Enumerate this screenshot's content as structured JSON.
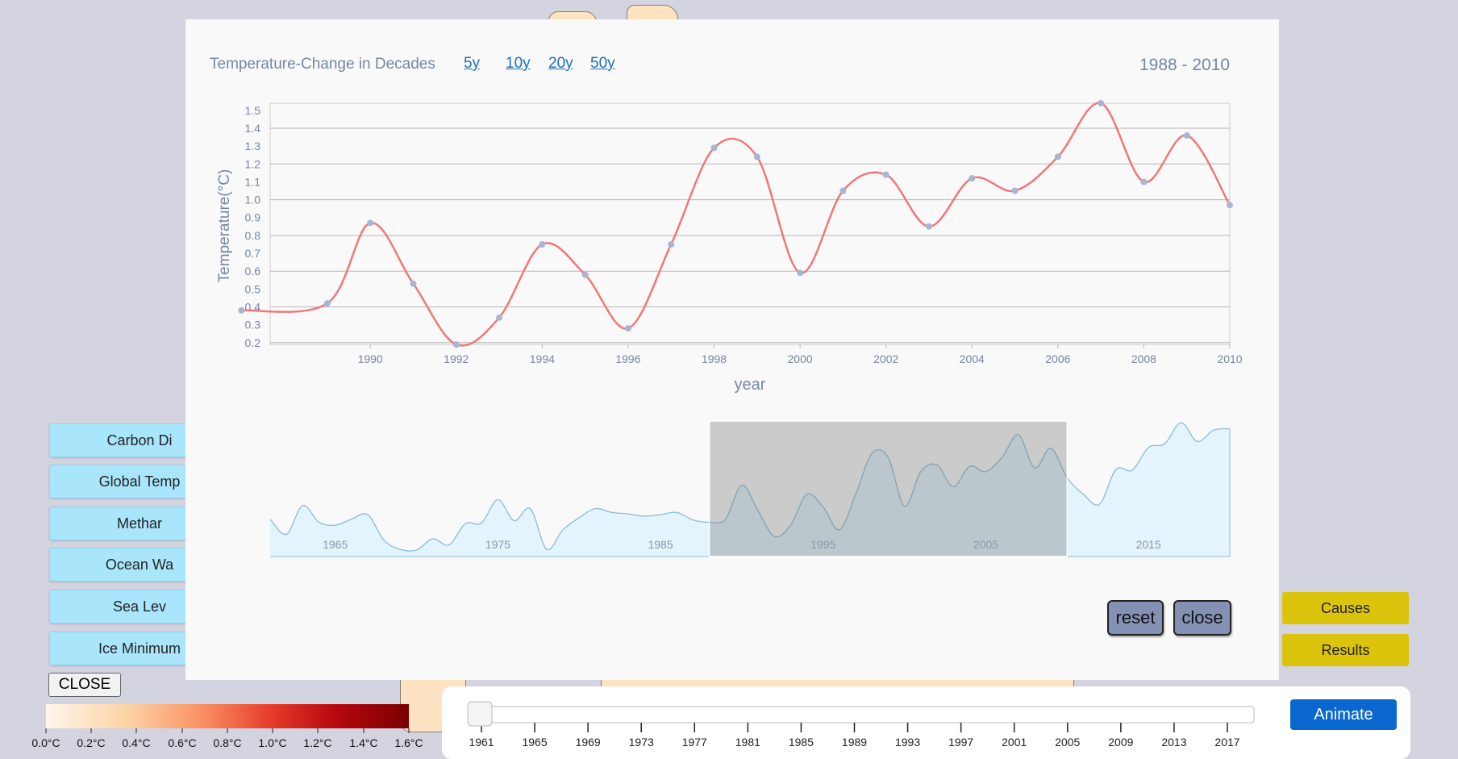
{
  "sidebar": {
    "buttons": [
      "Carbon Di",
      "Global Temp",
      "Methar",
      "Ocean Wa",
      "Sea Lev",
      "Ice Minimum"
    ],
    "close_label": "CLOSE"
  },
  "right_buttons": [
    "Causes",
    "Results"
  ],
  "color_legend": {
    "labels": [
      "0.0°C",
      "0.2°C",
      "0.4°C",
      "0.6°C",
      "0.8°C",
      "1.0°C",
      "1.2°C",
      "1.4°C",
      "1.6°C"
    ]
  },
  "timeline": {
    "years": [
      "1961",
      "1965",
      "1969",
      "1973",
      "1977",
      "1981",
      "1985",
      "1989",
      "1993",
      "1997",
      "2001",
      "2005",
      "2009",
      "2013",
      "2017"
    ],
    "value": 1961,
    "animate_label": "Animate"
  },
  "modal": {
    "title": "Temperature-Change in Decades",
    "range_links": [
      "5y",
      "10y",
      "20y",
      "50y"
    ],
    "year_range": "1988 - 2010",
    "reset_label": "reset",
    "close_label": "close"
  },
  "chart_data": {
    "type": "line",
    "xlabel": "year",
    "ylabel": "Temperature(°C)",
    "xlim": [
      1987.67,
      2010
    ],
    "ylim": [
      0.19,
      1.54
    ],
    "x_ticks": [
      1990,
      1992,
      1994,
      1996,
      1998,
      2000,
      2002,
      2004,
      2006,
      2008,
      2010
    ],
    "y_ticks": [
      0.2,
      0.3,
      0.4,
      0.5,
      0.6,
      0.7,
      0.8,
      0.9,
      1.0,
      1.1,
      1.2,
      1.3,
      1.4,
      1.5
    ],
    "x": [
      1987,
      1989,
      1990,
      1991,
      1992,
      1993,
      1994,
      1995,
      1996,
      1997,
      1998,
      1999,
      2000,
      2001,
      2002,
      2003,
      2004,
      2005,
      2006,
      2007,
      2008,
      2009,
      2010
    ],
    "y": [
      0.38,
      0.42,
      0.87,
      0.53,
      0.19,
      0.34,
      0.75,
      0.58,
      0.28,
      0.75,
      1.29,
      1.24,
      0.59,
      1.05,
      1.14,
      0.85,
      1.12,
      1.05,
      1.24,
      1.54,
      1.1,
      1.36,
      0.97
    ],
    "line_color": "#f07878",
    "point_color": "#a8b6d3",
    "navigator": {
      "x_ticks": [
        1965,
        1975,
        1985,
        1995,
        2005,
        2015
      ],
      "xlim": [
        1961,
        2020
      ],
      "selected_range": [
        1988,
        2010
      ],
      "series": [
        [
          1961,
          0.42
        ],
        [
          1962,
          0.22
        ],
        [
          1963,
          0.6
        ],
        [
          1964,
          0.38
        ],
        [
          1965,
          0.34
        ],
        [
          1966,
          0.42
        ],
        [
          1967,
          0.48
        ],
        [
          1968,
          0.14
        ],
        [
          1969,
          0.02
        ],
        [
          1970,
          0.01
        ],
        [
          1971,
          0.16
        ],
        [
          1972,
          0.08
        ],
        [
          1973,
          0.36
        ],
        [
          1974,
          0.37
        ],
        [
          1975,
          0.68
        ],
        [
          1976,
          0.4
        ],
        [
          1977,
          0.56
        ],
        [
          1978,
          0.02
        ],
        [
          1979,
          0.28
        ],
        [
          1980,
          0.44
        ],
        [
          1981,
          0.56
        ],
        [
          1982,
          0.51
        ],
        [
          1983,
          0.49
        ],
        [
          1984,
          0.46
        ],
        [
          1985,
          0.48
        ],
        [
          1986,
          0.51
        ],
        [
          1987,
          0.41
        ],
        [
          1988,
          0.38
        ],
        [
          1989,
          0.42
        ],
        [
          1990,
          0.87
        ],
        [
          1991,
          0.53
        ],
        [
          1992,
          0.19
        ],
        [
          1993,
          0.34
        ],
        [
          1994,
          0.75
        ],
        [
          1995,
          0.58
        ],
        [
          1996,
          0.28
        ],
        [
          1997,
          0.75
        ],
        [
          1998,
          1.29
        ],
        [
          1999,
          1.24
        ],
        [
          2000,
          0.59
        ],
        [
          2001,
          1.05
        ],
        [
          2002,
          1.14
        ],
        [
          2003,
          0.85
        ],
        [
          2004,
          1.12
        ],
        [
          2005,
          1.05
        ],
        [
          2006,
          1.24
        ],
        [
          2007,
          1.54
        ],
        [
          2008,
          1.1
        ],
        [
          2009,
          1.36
        ],
        [
          2010,
          0.97
        ],
        [
          2011,
          0.75
        ],
        [
          2012,
          0.62
        ],
        [
          2013,
          1.08
        ],
        [
          2014,
          1.07
        ],
        [
          2015,
          1.37
        ],
        [
          2016,
          1.42
        ],
        [
          2017,
          1.7
        ],
        [
          2018,
          1.45
        ],
        [
          2019,
          1.6
        ],
        [
          2020,
          1.62
        ]
      ]
    }
  }
}
